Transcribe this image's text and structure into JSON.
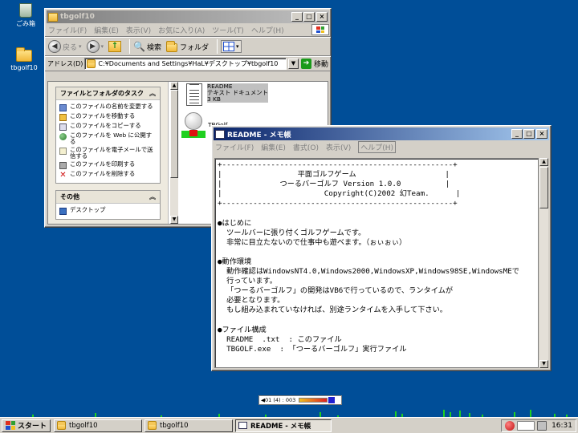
{
  "colors": {
    "desktop": "#004e98",
    "title_active": "#0a246a",
    "title_inactive": "#808080",
    "window_face": "#d4d0c8",
    "grass": "#1fd01f"
  },
  "desktop": {
    "icons": [
      {
        "label": "ごみ箱",
        "icon": "recycle-bin-icon"
      },
      {
        "label": "tbgolf10",
        "icon": "folder-icon"
      }
    ]
  },
  "explorer": {
    "title": "tbgolf10",
    "menu": [
      "ファイル(F)",
      "編集(E)",
      "表示(V)",
      "お気に入り(A)",
      "ツール(T)",
      "ヘルプ(H)"
    ],
    "toolbar": {
      "back": "戻る",
      "search": "検索",
      "folders": "フォルダ"
    },
    "address": {
      "label": "アドレス(D)",
      "value": "C:¥Documents and Settings¥HaL¥デスクトップ¥tbgolf10",
      "go": "移動"
    },
    "tasks_panel": {
      "title": "ファイルとフォルダのタスク",
      "items": [
        "このファイルの名前を変更する",
        "このファイルを移動する",
        "このファイルをコピーする",
        "このファイルを Web に公開する",
        "このファイルを電子メールで送信する",
        "このファイルを印刷する",
        "このファイルを削除する"
      ]
    },
    "other_panel": {
      "title": "その他",
      "items": [
        "デスクトップ"
      ]
    },
    "files": [
      {
        "name": "README",
        "type": "テキスト ドキュメント",
        "size": "3 KB"
      },
      {
        "name": "TBGolf"
      }
    ]
  },
  "notepad": {
    "title": "README - メモ帳",
    "menu": [
      "ファイル(F)",
      "編集(E)",
      "書式(O)",
      "表示(V)",
      "ヘルプ(H)"
    ],
    "lines": [
      "+----------------------------------------------------+",
      "|                 平面ゴルフゲーム                    |",
      "|             つーるバーゴルフ Version 1.0.0          |",
      "|                       Copyright(C)2002 幻Team.      |",
      "+----------------------------------------------------+",
      "",
      "●はじめに",
      "  ツールバーに張り付くゴルフゲームです。",
      "  非常に目立たないので仕事中も遊べます。（ぉぃぉぃ）",
      "",
      "●動作環境",
      "  動作確認はWindowsNT4.0,Windows2000,WindowsXP,Windows98SE,WindowsMEで",
      "  行っています。",
      "  「つーるバーゴルフ」の開発はVB6で行っているので、ランタイムが",
      "  必要となります。",
      "  もし組み込まれていなければ、別途ランタイムを入手して下さい。",
      "",
      "●ファイル構成",
      "  README  .txt  : このファイル",
      "  TBGOLF.exe  : 「つーるバーゴルフ」実行ファイル"
    ]
  },
  "game_status": {
    "text": "◀01 (4) : 003"
  },
  "taskbar": {
    "start": "スタート",
    "buttons": [
      "tbgolf10",
      "tbgolf10",
      "README - メモ帳"
    ],
    "clock": "16:31"
  }
}
